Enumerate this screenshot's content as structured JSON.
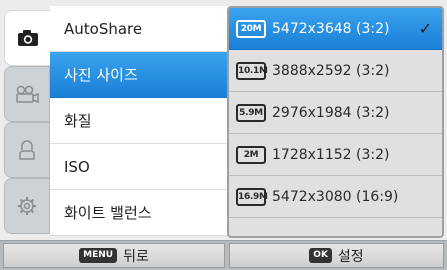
{
  "tabs": [
    {
      "icon": "camera-icon",
      "active": true
    },
    {
      "icon": "movie-camera-icon",
      "active": false
    },
    {
      "icon": "user-icon",
      "active": false
    },
    {
      "icon": "gear-icon",
      "active": false
    }
  ],
  "menu": {
    "items": [
      {
        "label": "AutoShare"
      },
      {
        "label": "사진 사이즈"
      },
      {
        "label": "화질"
      },
      {
        "label": "ISO"
      },
      {
        "label": "화이트 밸런스"
      }
    ],
    "selected_index": 1
  },
  "submenu": {
    "items": [
      {
        "badge": "20M",
        "label": "5472x3648 (3:2)"
      },
      {
        "badge": "10.1M",
        "label": "3888x2592 (3:2)"
      },
      {
        "badge": "5.9M",
        "label": "2976x1984 (3:2)"
      },
      {
        "badge": "2M",
        "label": "1728x1152 (3:2)"
      },
      {
        "badge": "16.9M",
        "label": "5472x3080 (16:9)"
      }
    ],
    "selected_index": 0,
    "check_mark": "✓"
  },
  "bottom": {
    "back_key": "MENU",
    "back_label": "뒤로",
    "ok_key": "OK",
    "ok_label": "설정"
  }
}
